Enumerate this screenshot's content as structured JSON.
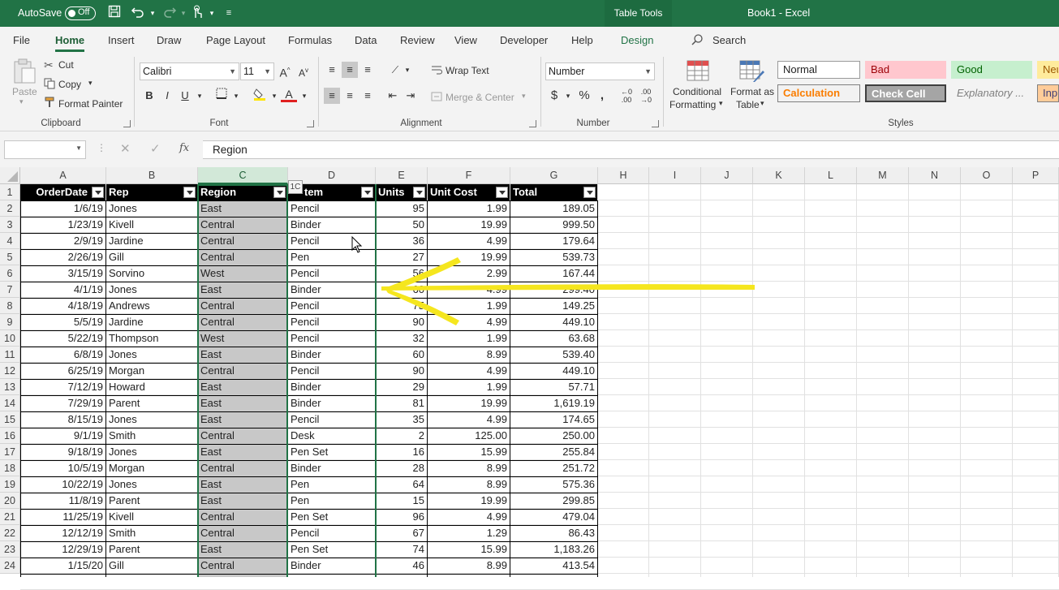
{
  "titlebar": {
    "autosave_label": "AutoSave",
    "autosave_state": "Off",
    "context_tab": "Table Tools",
    "doc_title": "Book1  -  Excel"
  },
  "tabs": [
    "File",
    "Home",
    "Insert",
    "Draw",
    "Page Layout",
    "Formulas",
    "Data",
    "Review",
    "View",
    "Developer",
    "Help",
    "Design"
  ],
  "active_tab": "Home",
  "search_label": "Search",
  "clipboard": {
    "paste": "Paste",
    "cut": "Cut",
    "copy": "Copy",
    "format_painter": "Format Painter",
    "label": "Clipboard"
  },
  "font": {
    "name": "Calibri",
    "size": "11",
    "label": "Font"
  },
  "alignment": {
    "wrap_text": "Wrap Text",
    "merge_center": "Merge & Center",
    "label": "Alignment"
  },
  "number": {
    "format": "Number",
    "label": "Number"
  },
  "styles_group": {
    "conditional": "Conditional",
    "formatting": "Formatting",
    "format_as": "Format as",
    "table": "Table",
    "label": "Styles",
    "gallery": [
      "Normal",
      "Bad",
      "Good",
      "Neu",
      "Calculation",
      "Check Cell",
      "Explanatory ...",
      "Inpu"
    ]
  },
  "formula_bar": {
    "name_box": "",
    "formula": "Region"
  },
  "paste_tag": "1C",
  "columns": [
    "A",
    "B",
    "C",
    "D",
    "E",
    "F",
    "G",
    "H",
    "I",
    "J",
    "K",
    "L",
    "M",
    "N",
    "O",
    "P"
  ],
  "headers": [
    "OrderDate",
    "Rep",
    "Region",
    "Item",
    "Units",
    "Unit Cost",
    "Total"
  ],
  "header_item_visible": "tem",
  "rows": [
    [
      "1/6/19",
      "Jones",
      "East",
      "Pencil",
      "95",
      "1.99",
      "189.05"
    ],
    [
      "1/23/19",
      "Kivell",
      "Central",
      "Binder",
      "50",
      "19.99",
      "999.50"
    ],
    [
      "2/9/19",
      "Jardine",
      "Central",
      "Pencil",
      "36",
      "4.99",
      "179.64"
    ],
    [
      "2/26/19",
      "Gill",
      "Central",
      "Pen",
      "27",
      "19.99",
      "539.73"
    ],
    [
      "3/15/19",
      "Sorvino",
      "West",
      "Pencil",
      "56",
      "2.99",
      "167.44"
    ],
    [
      "4/1/19",
      "Jones",
      "East",
      "Binder",
      "60",
      "4.99",
      "299.40"
    ],
    [
      "4/18/19",
      "Andrews",
      "Central",
      "Pencil",
      "75",
      "1.99",
      "149.25"
    ],
    [
      "5/5/19",
      "Jardine",
      "Central",
      "Pencil",
      "90",
      "4.99",
      "449.10"
    ],
    [
      "5/22/19",
      "Thompson",
      "West",
      "Pencil",
      "32",
      "1.99",
      "63.68"
    ],
    [
      "6/8/19",
      "Jones",
      "East",
      "Binder",
      "60",
      "8.99",
      "539.40"
    ],
    [
      "6/25/19",
      "Morgan",
      "Central",
      "Pencil",
      "90",
      "4.99",
      "449.10"
    ],
    [
      "7/12/19",
      "Howard",
      "East",
      "Binder",
      "29",
      "1.99",
      "57.71"
    ],
    [
      "7/29/19",
      "Parent",
      "East",
      "Binder",
      "81",
      "19.99",
      "1,619.19"
    ],
    [
      "8/15/19",
      "Jones",
      "East",
      "Pencil",
      "35",
      "4.99",
      "174.65"
    ],
    [
      "9/1/19",
      "Smith",
      "Central",
      "Desk",
      "2",
      "125.00",
      "250.00"
    ],
    [
      "9/18/19",
      "Jones",
      "East",
      "Pen Set",
      "16",
      "15.99",
      "255.84"
    ],
    [
      "10/5/19",
      "Morgan",
      "Central",
      "Binder",
      "28",
      "8.99",
      "251.72"
    ],
    [
      "10/22/19",
      "Jones",
      "East",
      "Pen",
      "64",
      "8.99",
      "575.36"
    ],
    [
      "11/8/19",
      "Parent",
      "East",
      "Pen",
      "15",
      "19.99",
      "299.85"
    ],
    [
      "11/25/19",
      "Kivell",
      "Central",
      "Pen Set",
      "96",
      "4.99",
      "479.04"
    ],
    [
      "12/12/19",
      "Smith",
      "Central",
      "Pencil",
      "67",
      "1.29",
      "86.43"
    ],
    [
      "12/29/19",
      "Parent",
      "East",
      "Pen Set",
      "74",
      "15.99",
      "1,183.26"
    ],
    [
      "1/15/20",
      "Gill",
      "Central",
      "Binder",
      "46",
      "8.99",
      "413.54"
    ]
  ],
  "colors": {
    "excel_green": "#217346",
    "selection_fill": "#c8c8c8",
    "arrow_yellow": "#f5e61e"
  }
}
